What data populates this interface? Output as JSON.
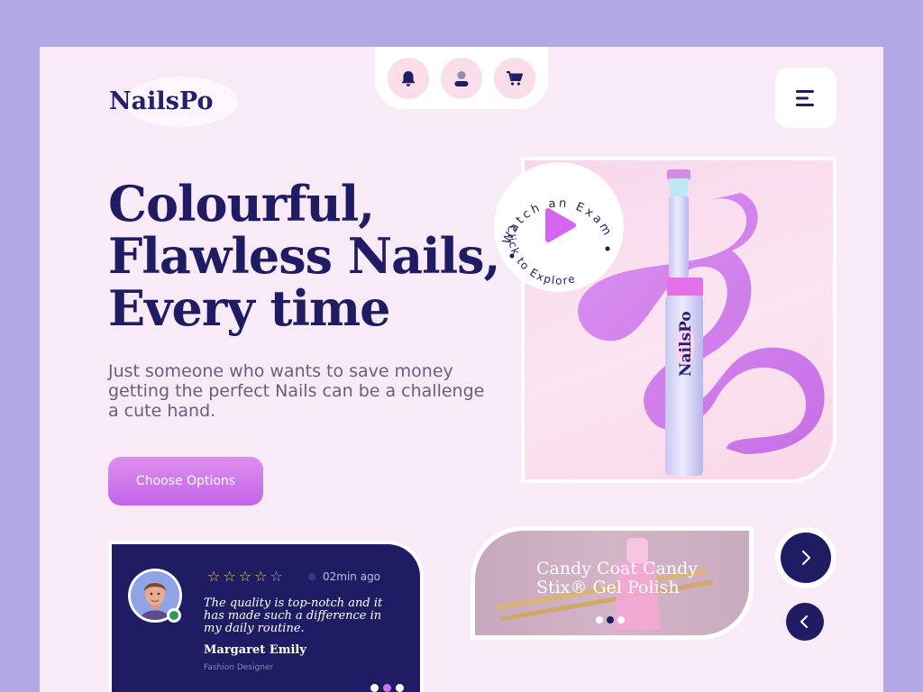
{
  "brand": {
    "name": "NailsPo"
  },
  "nav": {
    "icons": [
      "bell-icon",
      "user-icon",
      "cart-icon"
    ],
    "menu_icon": "hamburger-menu-icon"
  },
  "hero": {
    "title_line1": "Colourful,",
    "title_line2": "Flawless Nails,",
    "title_line3": "Every time",
    "description": "Just someone who wants to save money getting the perfect Nails can be a challenge a cute hand.",
    "cta_label": "Choose Options"
  },
  "watch": {
    "outer_text": "Watch an Example",
    "inner_text": "Click to Explore",
    "play_icon": "play-icon"
  },
  "product_image": {
    "pen_label": "NailsPo"
  },
  "review": {
    "rating": 4,
    "max_rating": 5,
    "time": "02min ago",
    "quote": "The quality is top-notch and it has made such a difference in my daily routine.",
    "name": "Margaret Emily",
    "role": "Fashion Designer",
    "active_dot": 1
  },
  "product_card": {
    "title": "Candy Coat Candy Stix® Gel Polish",
    "active_dot": 1
  },
  "colors": {
    "navy": "#1f1c64",
    "lavender_bg": "#b2a8e6",
    "page_bg": "#f8eaf7",
    "accent_purple": "#c464e8",
    "star_yellow": "#f2d43c"
  }
}
